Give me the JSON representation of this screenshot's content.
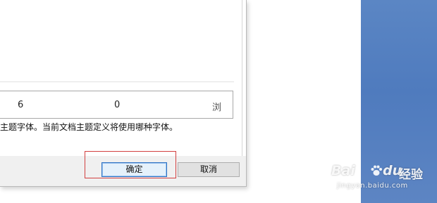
{
  "preview": {
    "cell_a": "6",
    "cell_b": "0",
    "cell_c": "浏"
  },
  "description": "主题字体。当前文档主题定义将使用哪种字体。",
  "buttons": {
    "ok": "确定",
    "cancel": "取消"
  },
  "watermark": {
    "logo_b": "Bai",
    "logo_du": "du",
    "jingyan": "经验",
    "url": "jingyan.baidu.com"
  },
  "colors": {
    "highlight": "#d24040",
    "desktop": "#5b86c4",
    "ok_button_border": "#2d72c4"
  }
}
